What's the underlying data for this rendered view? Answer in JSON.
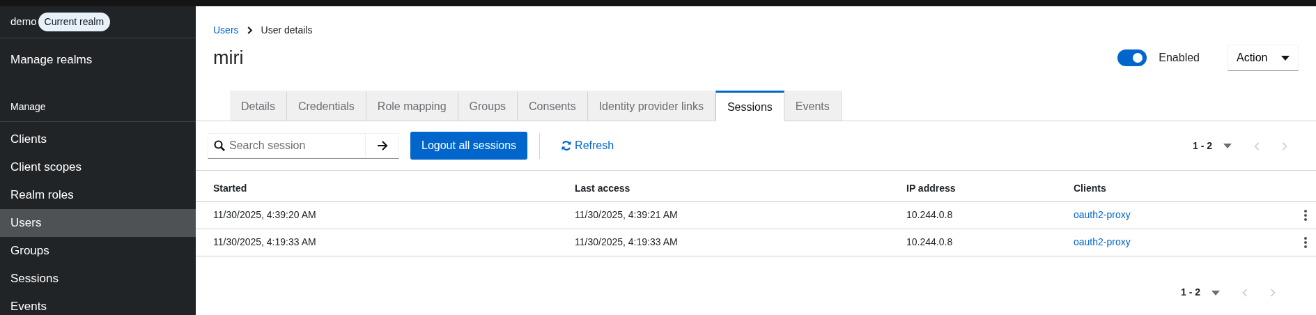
{
  "sidebar": {
    "realm": "demo",
    "realm_badge": "Current realm",
    "manage_realms": "Manage realms",
    "section": "Manage",
    "items": [
      {
        "label": "Clients",
        "selected": false
      },
      {
        "label": "Client scopes",
        "selected": false
      },
      {
        "label": "Realm roles",
        "selected": false
      },
      {
        "label": "Users",
        "selected": true
      },
      {
        "label": "Groups",
        "selected": false
      },
      {
        "label": "Sessions",
        "selected": false
      },
      {
        "label": "Events",
        "selected": false
      }
    ]
  },
  "breadcrumb": [
    {
      "label": "Users",
      "kind": "link"
    },
    {
      "label": "User details",
      "kind": "current"
    }
  ],
  "title": "miri",
  "enabled_toggle": {
    "on": true,
    "label": "Enabled"
  },
  "action_menu": "Action",
  "tabs": [
    {
      "label": "Details",
      "selected": false
    },
    {
      "label": "Credentials",
      "selected": false
    },
    {
      "label": "Role mapping",
      "selected": false
    },
    {
      "label": "Groups",
      "selected": false
    },
    {
      "label": "Consents",
      "selected": false
    },
    {
      "label": "Identity provider links",
      "selected": false
    },
    {
      "label": "Sessions",
      "selected": true
    },
    {
      "label": "Events",
      "selected": false
    }
  ],
  "toolbar": {
    "search": {
      "placeholder": "Search session"
    },
    "logout_button": "Logout all sessions",
    "refresh": "Refresh"
  },
  "pagination_top": {
    "range": "1 - 2",
    "menu_expanded": false,
    "prev_disabled": true,
    "next_disabled": true
  },
  "table": {
    "columns": [
      "Started",
      "Last access",
      "IP address",
      "Clients"
    ],
    "rows": [
      {
        "started": "11/30/2025, 4:39:20 AM",
        "last_access": "11/30/2025, 4:39:21 AM",
        "ip": "10.244.0.8",
        "client": "oauth2-proxy"
      },
      {
        "started": "11/30/2025, 4:19:33 AM",
        "last_access": "11/30/2025, 4:19:33 AM",
        "ip": "10.244.0.8",
        "client": "oauth2-proxy"
      }
    ]
  },
  "pagination_bottom": {
    "range": "1 - 2",
    "menu_expanded": false,
    "prev_disabled": true,
    "next_disabled": true
  }
}
